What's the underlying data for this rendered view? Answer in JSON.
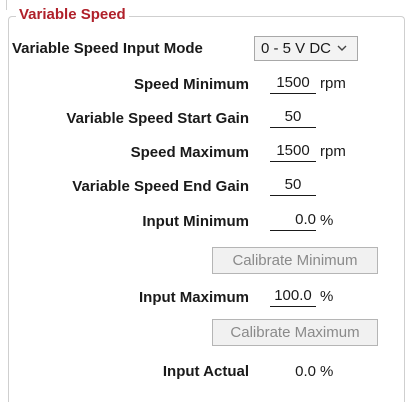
{
  "group": {
    "title": "Variable Speed"
  },
  "input_mode": {
    "label": "Variable Speed Input Mode",
    "selected": "0 - 5 V DC",
    "icon": "chevron-down-icon"
  },
  "fields": {
    "speed_min": {
      "label": "Speed Minimum",
      "value": "1500",
      "unit": "rpm"
    },
    "start_gain": {
      "label": "Variable Speed Start Gain",
      "value": "50"
    },
    "speed_max": {
      "label": "Speed Maximum",
      "value": "1500",
      "unit": "rpm"
    },
    "end_gain": {
      "label": "Variable Speed End Gain",
      "value": "50"
    },
    "input_min": {
      "label": "Input Minimum",
      "value": "0.0",
      "unit": "%"
    },
    "input_max": {
      "label": "Input Maximum",
      "value": "100.0",
      "unit": "%"
    },
    "input_actual": {
      "label": "Input Actual",
      "value": "0.0",
      "unit": "%"
    }
  },
  "buttons": {
    "calibrate_min": "Calibrate Minimum",
    "calibrate_max": "Calibrate Maximum"
  },
  "colors": {
    "title": "#b0202a",
    "disabled_text": "#8a8a8a"
  }
}
